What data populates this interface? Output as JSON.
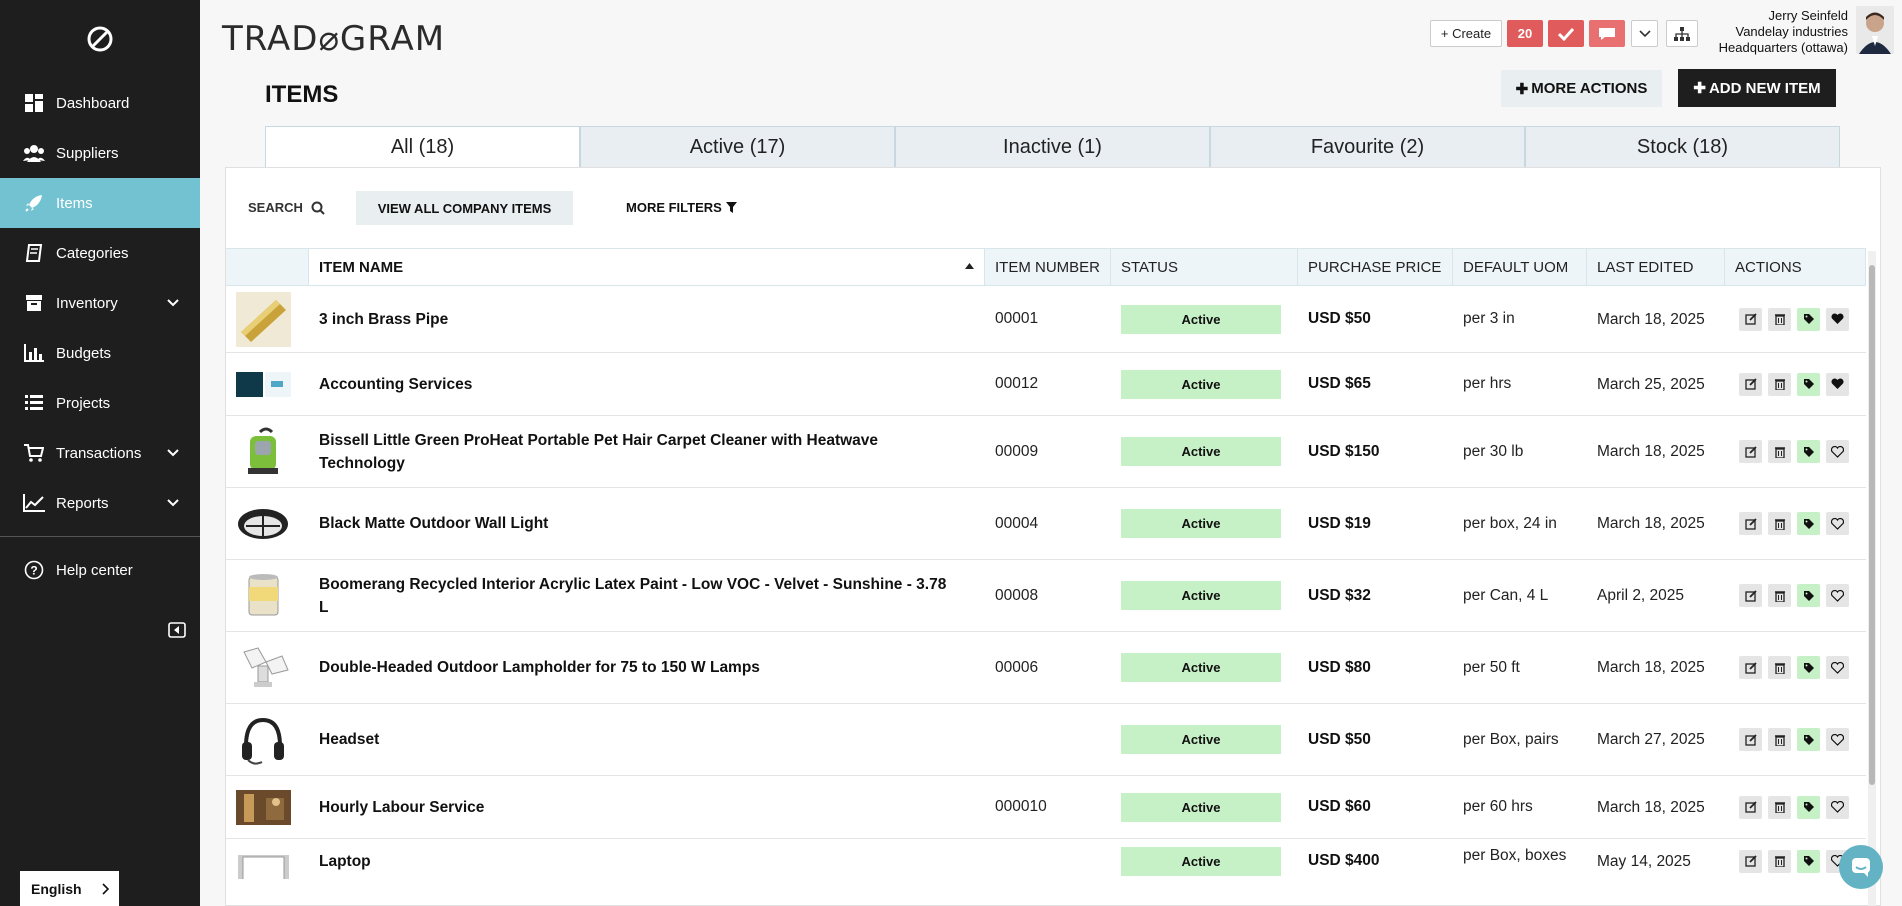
{
  "sidebar": {
    "items": [
      {
        "label": "Dashboard",
        "icon": "dashboard-icon"
      },
      {
        "label": "Suppliers",
        "icon": "users-icon"
      },
      {
        "label": "Items",
        "icon": "rocket-icon",
        "active": true
      },
      {
        "label": "Categories",
        "icon": "book-icon"
      },
      {
        "label": "Inventory",
        "icon": "archive-icon",
        "has_submenu": true
      },
      {
        "label": "Budgets",
        "icon": "bar-chart-icon"
      },
      {
        "label": "Projects",
        "icon": "list-icon"
      },
      {
        "label": "Transactions",
        "icon": "cart-icon",
        "has_submenu": true
      },
      {
        "label": "Reports",
        "icon": "line-chart-icon",
        "has_submenu": true
      }
    ],
    "help_label": "Help center",
    "language": "English"
  },
  "header": {
    "logo_text": "TRAD⌀GRAM",
    "create_label": "+ Create",
    "notification_count": "20",
    "user": {
      "name": "Jerry Seinfeld",
      "company": "Vandelay industries",
      "location": "Headquarters (ottawa)"
    }
  },
  "page": {
    "title": "ITEMS",
    "more_actions_label": "MORE ACTIONS",
    "add_item_label": "ADD NEW ITEM"
  },
  "tabs": [
    {
      "label": "All (18)",
      "active": true
    },
    {
      "label": "Active (17)"
    },
    {
      "label": "Inactive (1)"
    },
    {
      "label": "Favourite (2)"
    },
    {
      "label": "Stock (18)"
    }
  ],
  "filters": {
    "search_label": "SEARCH",
    "view_all_label": "VIEW ALL COMPANY ITEMS",
    "more_filters_label": "MORE FILTERS"
  },
  "table": {
    "columns": [
      "ITEM NAME",
      "ITEM NUMBER",
      "STATUS",
      "PURCHASE PRICE",
      "DEFAULT UOM",
      "LAST EDITED",
      "ACTIONS"
    ],
    "rows": [
      {
        "name": "3 inch Brass Pipe",
        "number": "00001",
        "status": "Active",
        "price": "USD $50",
        "uom": "per 3 in",
        "edited": "March 18, 2025",
        "favourite": true
      },
      {
        "name": "Accounting Services",
        "number": "00012",
        "status": "Active",
        "price": "USD $65",
        "uom": "per hrs",
        "edited": "March 25, 2025",
        "favourite": true
      },
      {
        "name": "Bissell Little Green ProHeat Portable Pet Hair Carpet Cleaner with Heatwave Technology",
        "number": "00009",
        "status": "Active",
        "price": "USD $150",
        "uom": "per 30 lb",
        "edited": "March 18, 2025",
        "favourite": false
      },
      {
        "name": "Black Matte Outdoor Wall Light",
        "number": "00004",
        "status": "Active",
        "price": "USD $19",
        "uom": "per box, 24 in",
        "edited": "March 18, 2025",
        "favourite": false
      },
      {
        "name": "Boomerang Recycled Interior Acrylic Latex Paint - Low VOC - Velvet - Sunshine - 3.78 L",
        "number": "00008",
        "status": "Active",
        "price": "USD $32",
        "uom": "per Can, 4 L",
        "edited": "April 2, 2025",
        "favourite": false
      },
      {
        "name": "Double-Headed Outdoor Lampholder for 75 to 150 W Lamps",
        "number": "00006",
        "status": "Active",
        "price": "USD $80",
        "uom": "per 50 ft",
        "edited": "March 18, 2025",
        "favourite": false
      },
      {
        "name": "Headset",
        "number": "",
        "status": "Active",
        "price": "USD $50",
        "uom": "per Box, pairs",
        "edited": "March 27, 2025",
        "favourite": false
      },
      {
        "name": "Hourly Labour Service",
        "number": "000010",
        "status": "Active",
        "price": "USD $60",
        "uom": "per 60 hrs",
        "edited": "March 18, 2025",
        "favourite": false
      },
      {
        "name": "Laptop",
        "number": "",
        "status": "Active",
        "price": "USD $400",
        "uom": "per Box, boxes",
        "edited": "May 14, 2025",
        "favourite": false
      }
    ]
  },
  "colors": {
    "sidebar_bg": "#1e1e1e",
    "active_nav": "#72c2d1",
    "status_active": "#c6f0c6",
    "badge_red": "#e05b5b"
  }
}
